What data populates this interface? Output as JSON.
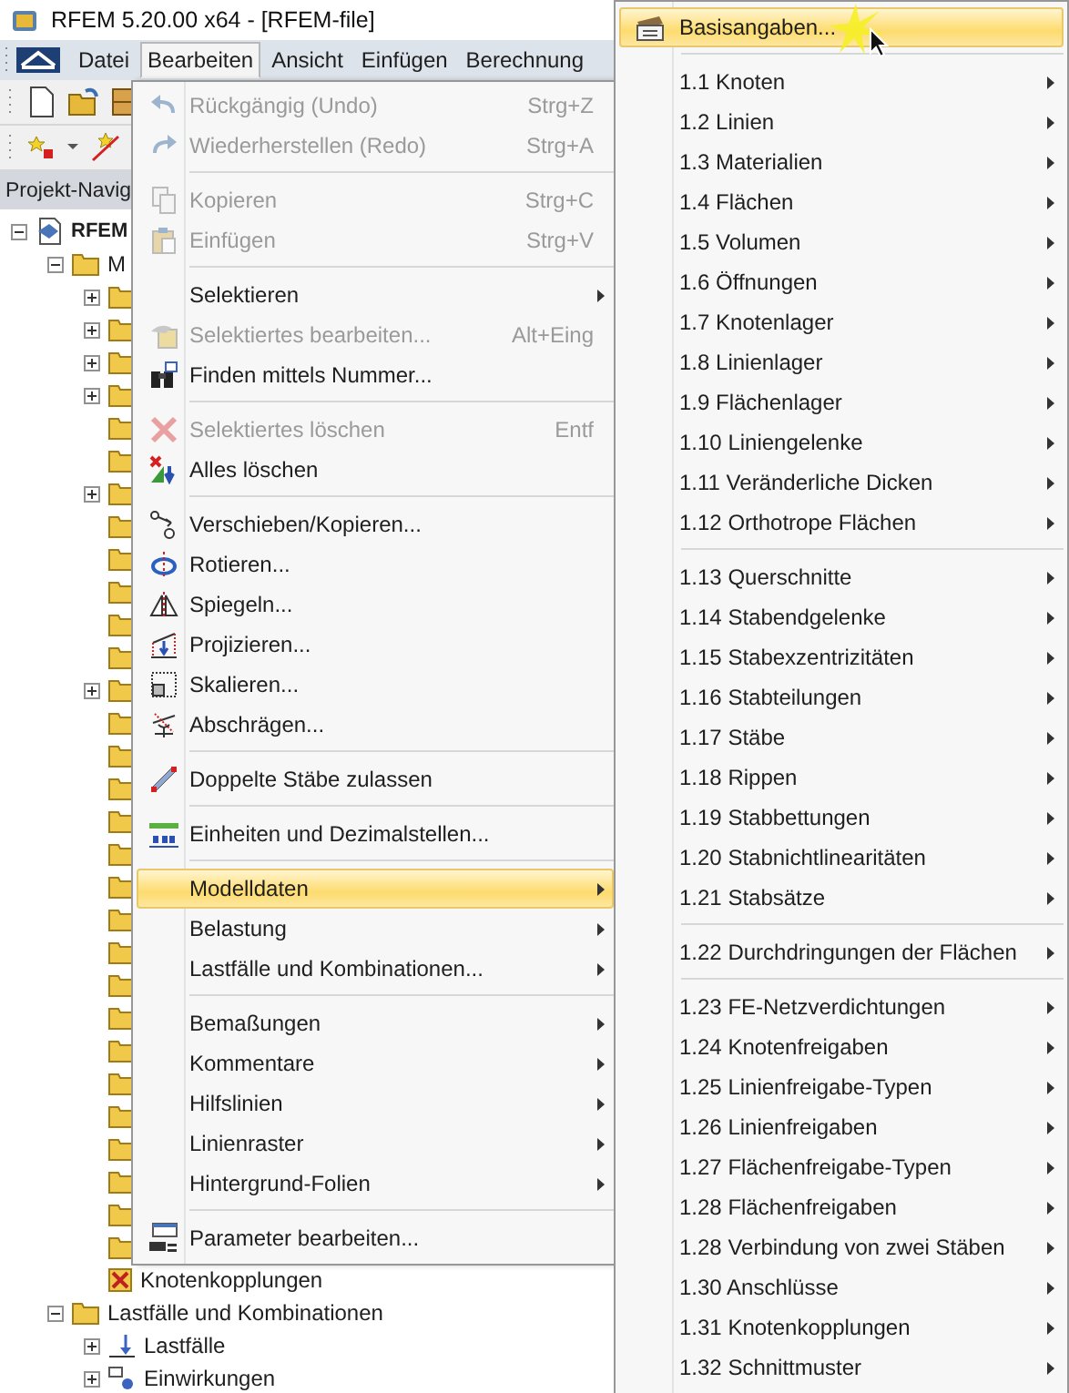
{
  "window": {
    "title": "RFEM 5.20.00 x64 - [RFEM-file]"
  },
  "menu_bar": [
    {
      "label": "Datei",
      "selected": false
    },
    {
      "label": "Bearbeiten",
      "selected": true
    },
    {
      "label": "Ansicht",
      "selected": false
    },
    {
      "label": "Einfügen",
      "selected": false
    },
    {
      "label": "Berechnung",
      "selected": false
    }
  ],
  "navigator": {
    "title": "Projekt-Navig",
    "tree": [
      {
        "kind": "model",
        "label": "RFEM",
        "expanded": true,
        "children": [
          {
            "kind": "folder",
            "label": "M",
            "expanded": true,
            "children": [
              {
                "kind": "folder",
                "expanded": false
              },
              {
                "kind": "folder",
                "expanded": false
              },
              {
                "kind": "folder",
                "expanded": false
              },
              {
                "kind": "folder",
                "expanded": false
              },
              {
                "kind": "folder"
              },
              {
                "kind": "folder"
              },
              {
                "kind": "folder",
                "expanded": false
              },
              {
                "kind": "folder"
              },
              {
                "kind": "folder"
              },
              {
                "kind": "folder"
              },
              {
                "kind": "folder"
              },
              {
                "kind": "folder"
              },
              {
                "kind": "folder",
                "expanded": false
              },
              {
                "kind": "folder"
              },
              {
                "kind": "folder"
              },
              {
                "kind": "folder"
              },
              {
                "kind": "folder"
              },
              {
                "kind": "folder"
              },
              {
                "kind": "folder"
              },
              {
                "kind": "folder"
              },
              {
                "kind": "folder"
              },
              {
                "kind": "folder"
              },
              {
                "kind": "folder"
              },
              {
                "kind": "folder"
              },
              {
                "kind": "folder"
              },
              {
                "kind": "folder"
              },
              {
                "kind": "folder"
              },
              {
                "kind": "folder"
              },
              {
                "kind": "folder"
              },
              {
                "kind": "folder"
              },
              {
                "kind": "coupling",
                "label": "Knotenkopplungen"
              }
            ]
          },
          {
            "kind": "folder",
            "label": "Lastfälle und Kombinationen",
            "expanded": true,
            "children": [
              {
                "kind": "load-case",
                "label": "Lastfälle",
                "expanded": false
              },
              {
                "kind": "action",
                "label": "Einwirkungen",
                "expanded": false
              }
            ]
          }
        ]
      }
    ]
  },
  "edit_menu": [
    {
      "kind": "item",
      "label": "Rückgängig (Undo)",
      "shortcut": "Strg+Z",
      "disabled": true,
      "submenu": false,
      "selected": false
    },
    {
      "kind": "item",
      "label": "Wiederherstellen (Redo)",
      "shortcut": "Strg+A",
      "disabled": true,
      "submenu": false,
      "selected": false
    },
    {
      "kind": "separator"
    },
    {
      "kind": "item",
      "label": "Kopieren",
      "shortcut": "Strg+C",
      "disabled": true,
      "submenu": false,
      "selected": false
    },
    {
      "kind": "item",
      "label": "Einfügen",
      "shortcut": "Strg+V",
      "disabled": true,
      "submenu": false,
      "selected": false
    },
    {
      "kind": "separator"
    },
    {
      "kind": "item",
      "label": "Selektieren",
      "disabled": false,
      "submenu": true,
      "selected": false
    },
    {
      "kind": "item",
      "label": "Selektiertes bearbeiten...",
      "shortcut": "Alt+Eing",
      "disabled": true,
      "submenu": false,
      "selected": false
    },
    {
      "kind": "item",
      "label": "Finden mittels Nummer...",
      "disabled": false,
      "submenu": false,
      "selected": false
    },
    {
      "kind": "separator"
    },
    {
      "kind": "item",
      "label": "Selektiertes löschen",
      "shortcut": "Entf",
      "disabled": true,
      "submenu": false,
      "selected": false
    },
    {
      "kind": "item",
      "label": "Alles löschen",
      "disabled": false,
      "submenu": false,
      "selected": false
    },
    {
      "kind": "separator"
    },
    {
      "kind": "item",
      "label": "Verschieben/Kopieren...",
      "disabled": false,
      "submenu": false,
      "selected": false
    },
    {
      "kind": "item",
      "label": "Rotieren...",
      "disabled": false,
      "submenu": false,
      "selected": false
    },
    {
      "kind": "item",
      "label": "Spiegeln...",
      "disabled": false,
      "submenu": false,
      "selected": false
    },
    {
      "kind": "item",
      "label": "Projizieren...",
      "disabled": false,
      "submenu": false,
      "selected": false
    },
    {
      "kind": "item",
      "label": "Skalieren...",
      "disabled": false,
      "submenu": false,
      "selected": false
    },
    {
      "kind": "item",
      "label": "Abschrägen...",
      "disabled": false,
      "submenu": false,
      "selected": false
    },
    {
      "kind": "separator"
    },
    {
      "kind": "item",
      "label": "Doppelte Stäbe zulassen",
      "disabled": false,
      "submenu": false,
      "selected": false
    },
    {
      "kind": "separator"
    },
    {
      "kind": "item",
      "label": "Einheiten und Dezimalstellen...",
      "disabled": false,
      "submenu": false,
      "selected": false
    },
    {
      "kind": "separator"
    },
    {
      "kind": "item",
      "label": "Modelldaten",
      "disabled": false,
      "submenu": true,
      "selected": true
    },
    {
      "kind": "item",
      "label": "Belastung",
      "disabled": false,
      "submenu": true,
      "selected": false
    },
    {
      "kind": "item",
      "label": "Lastfälle und Kombinationen...",
      "disabled": false,
      "submenu": true,
      "selected": false
    },
    {
      "kind": "separator"
    },
    {
      "kind": "item",
      "label": "Bemaßungen",
      "disabled": false,
      "submenu": true,
      "selected": false
    },
    {
      "kind": "item",
      "label": "Kommentare",
      "disabled": false,
      "submenu": true,
      "selected": false
    },
    {
      "kind": "item",
      "label": "Hilfslinien",
      "disabled": false,
      "submenu": true,
      "selected": false
    },
    {
      "kind": "item",
      "label": "Linienraster",
      "disabled": false,
      "submenu": true,
      "selected": false
    },
    {
      "kind": "item",
      "label": "Hintergrund-Folien",
      "disabled": false,
      "submenu": true,
      "selected": false
    },
    {
      "kind": "separator"
    },
    {
      "kind": "item",
      "label": "Parameter bearbeiten...",
      "disabled": false,
      "submenu": false,
      "selected": false
    }
  ],
  "model_data_menu": [
    {
      "kind": "item",
      "label": "Basisangaben...",
      "submenu": false,
      "selected": true
    },
    {
      "kind": "separator"
    },
    {
      "kind": "item",
      "label": "1.1 Knoten",
      "submenu": true,
      "selected": false
    },
    {
      "kind": "item",
      "label": "1.2 Linien",
      "submenu": true,
      "selected": false
    },
    {
      "kind": "item",
      "label": "1.3 Materialien",
      "submenu": true,
      "selected": false
    },
    {
      "kind": "item",
      "label": "1.4 Flächen",
      "submenu": true,
      "selected": false
    },
    {
      "kind": "item",
      "label": "1.5 Volumen",
      "submenu": true,
      "selected": false
    },
    {
      "kind": "item",
      "label": "1.6 Öffnungen",
      "submenu": true,
      "selected": false
    },
    {
      "kind": "item",
      "label": "1.7 Knotenlager",
      "submenu": true,
      "selected": false
    },
    {
      "kind": "item",
      "label": "1.8 Linienlager",
      "submenu": true,
      "selected": false
    },
    {
      "kind": "item",
      "label": "1.9 Flächenlager",
      "submenu": true,
      "selected": false
    },
    {
      "kind": "item",
      "label": "1.10 Liniengelenke",
      "submenu": true,
      "selected": false
    },
    {
      "kind": "item",
      "label": "1.11 Veränderliche Dicken",
      "submenu": true,
      "selected": false
    },
    {
      "kind": "item",
      "label": "1.12 Orthotrope Flächen",
      "submenu": true,
      "selected": false
    },
    {
      "kind": "separator"
    },
    {
      "kind": "item",
      "label": "1.13 Querschnitte",
      "submenu": true,
      "selected": false
    },
    {
      "kind": "item",
      "label": "1.14 Stabendgelenke",
      "submenu": true,
      "selected": false
    },
    {
      "kind": "item",
      "label": "1.15 Stabexzentrizitäten",
      "submenu": true,
      "selected": false
    },
    {
      "kind": "item",
      "label": "1.16 Stabteilungen",
      "submenu": true,
      "selected": false
    },
    {
      "kind": "item",
      "label": "1.17 Stäbe",
      "submenu": true,
      "selected": false
    },
    {
      "kind": "item",
      "label": "1.18 Rippen",
      "submenu": true,
      "selected": false
    },
    {
      "kind": "item",
      "label": "1.19 Stabbettungen",
      "submenu": true,
      "selected": false
    },
    {
      "kind": "item",
      "label": "1.20 Stabnichtlinearitäten",
      "submenu": true,
      "selected": false
    },
    {
      "kind": "item",
      "label": "1.21 Stabsätze",
      "submenu": true,
      "selected": false
    },
    {
      "kind": "separator"
    },
    {
      "kind": "item",
      "label": "1.22 Durchdringungen der Flächen",
      "submenu": true,
      "selected": false
    },
    {
      "kind": "separator"
    },
    {
      "kind": "item",
      "label": "1.23 FE-Netzverdichtungen",
      "submenu": true,
      "selected": false
    },
    {
      "kind": "item",
      "label": "1.24 Knotenfreigaben",
      "submenu": true,
      "selected": false
    },
    {
      "kind": "item",
      "label": "1.25 Linienfreigabe-Typen",
      "submenu": true,
      "selected": false
    },
    {
      "kind": "item",
      "label": "1.26 Linienfreigaben",
      "submenu": true,
      "selected": false
    },
    {
      "kind": "item",
      "label": "1.27 Flächenfreigabe-Typen",
      "submenu": true,
      "selected": false
    },
    {
      "kind": "item",
      "label": "1.28 Flächenfreigaben",
      "submenu": true,
      "selected": false
    },
    {
      "kind": "item",
      "label": "1.28 Verbindung von zwei Stäben",
      "submenu": true,
      "selected": false
    },
    {
      "kind": "item",
      "label": "1.30 Anschlüsse",
      "submenu": true,
      "selected": false
    },
    {
      "kind": "item",
      "label": "1.31 Knotenkopplungen",
      "submenu": true,
      "selected": false
    },
    {
      "kind": "item",
      "label": "1.32 Schnittmuster",
      "submenu": true,
      "selected": false
    }
  ]
}
